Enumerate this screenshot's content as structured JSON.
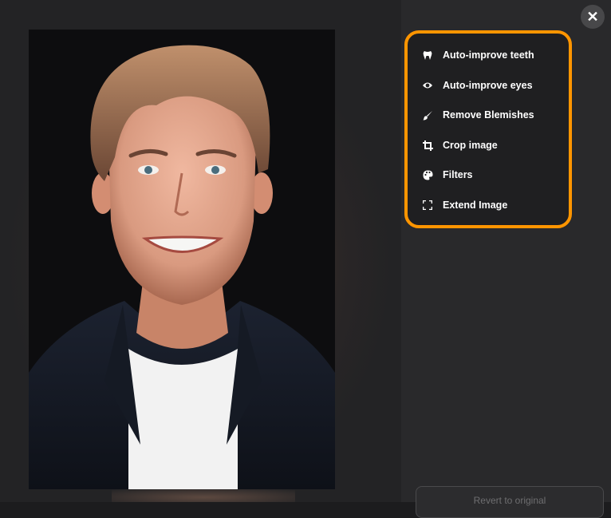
{
  "toolbar": {
    "close_symbol": "✕"
  },
  "menu": {
    "items": [
      {
        "label": "Auto-improve teeth",
        "icon": "tooth-icon"
      },
      {
        "label": "Auto-improve eyes",
        "icon": "eye-icon"
      },
      {
        "label": "Remove Blemishes",
        "icon": "brush-icon"
      },
      {
        "label": "Crop image",
        "icon": "crop-icon"
      },
      {
        "label": "Filters",
        "icon": "palette-icon"
      },
      {
        "label": "Extend Image",
        "icon": "expand-icon"
      }
    ],
    "highlight_color": "#ff9500"
  },
  "footer": {
    "revert_label": "Revert to original"
  }
}
